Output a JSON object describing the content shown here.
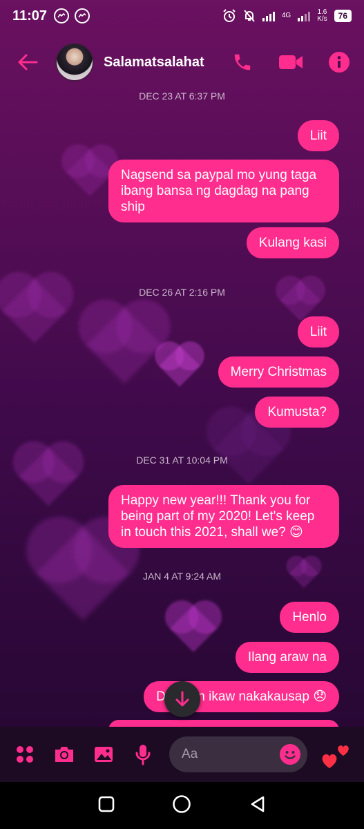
{
  "status": {
    "time": "11:07",
    "net_type": "4G",
    "speed_value": "1.6",
    "speed_unit": "K/s",
    "battery": "76"
  },
  "header": {
    "contact_name": "Salamatsalahat",
    "icons": [
      "back-arrow-icon",
      "phone-icon",
      "video-icon",
      "info-icon"
    ]
  },
  "colors": {
    "accent": "#ff2d8d",
    "background": "#4a0c50"
  },
  "conversation": [
    {
      "timestamp": "DEC 23 AT 6:37 PM",
      "messages": [
        "Liit",
        "Nagsend sa paypal mo yung taga ibang bansa ng dagdag na pang ship",
        "Kulang kasi"
      ]
    },
    {
      "timestamp": "DEC 26 AT 2:16 PM",
      "messages": [
        "Liit",
        "Merry Christmas",
        "Kumusta?"
      ]
    },
    {
      "timestamp": "DEC 31 AT 10:04 PM",
      "messages": [
        "Happy new year!!! Thank you for being part of my 2020! Let's keep in touch this 2021, shall we? 😊"
      ]
    },
    {
      "timestamp": "JAN 4 AT 9:24 AM",
      "messages": [
        "Henlo",
        "Ilang araw na",
        "Di pa rin ikaw nakakausap 😞"
      ]
    }
  ],
  "composer": {
    "placeholder": "Aa"
  }
}
